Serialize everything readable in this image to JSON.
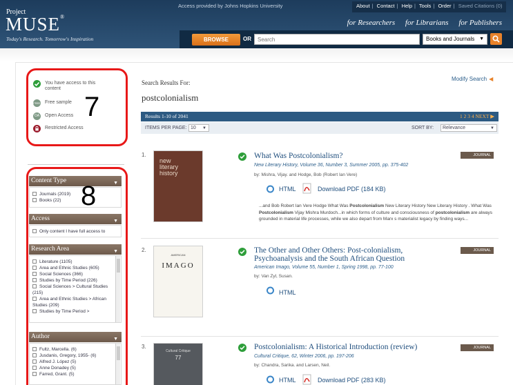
{
  "header": {
    "logo_project": "Project",
    "logo_muse": "MUSE",
    "logo_reg": "®",
    "tagline": "Today's Research. Tomorrow's Inspiration",
    "access_note": "Access provided by Johns Hopkins University",
    "top_links": [
      "About",
      "Contact",
      "Help",
      "Tools",
      "Order"
    ],
    "saved_citations": "Saved Citations (0)",
    "audiences": [
      "for Researchers",
      "for Librarians",
      "for Publishers"
    ],
    "browse_label": "BROWSE",
    "or_label": "OR",
    "search_placeholder": "Search",
    "scope_value": "Books and Journals"
  },
  "access_legend": {
    "items": [
      "You have access to this content",
      "Free sample",
      "Open Access",
      "Restricted Access"
    ],
    "annotation_number": "7"
  },
  "filters": {
    "annotation_number": "8",
    "content_type": {
      "title": "Content Type",
      "options": [
        "Journals (2019)",
        "Books (22)"
      ]
    },
    "access": {
      "title": "Access",
      "options": [
        "Only content I have full access to"
      ]
    },
    "research_area": {
      "title": "Research Area",
      "options": [
        "Literature (1105)",
        "Area and Ethnic Studies (605)",
        "Social Sciences (366)",
        "Studies by Time Period (226)",
        "Social Sciences > Cultural Studies (215)",
        "Area and Ethnic Studies > African Studies (209)",
        "Studies by Time Period >"
      ]
    },
    "author": {
      "title": "Author",
      "options": [
        "Fultz, Marcella. (6)",
        "Jusdanis, Gregory, 1955- (6)",
        "Alfred J. López (5)",
        "Anne Donadey (5)",
        "Farred, Grant. (5)"
      ]
    }
  },
  "results": {
    "label": "Search Results For:",
    "query": "postcolonialism",
    "modify_label": "Modify Search",
    "count_text": "Results 1-10 of 2041",
    "pages": [
      "1",
      "2",
      "3",
      "4"
    ],
    "next_label": "NEXT",
    "items_per_page_label": "ITEMS PER PAGE:",
    "items_per_page_value": "10",
    "sort_label": "SORT BY:",
    "sort_value": "Relevance",
    "items": [
      {
        "num": "1.",
        "title": "What Was Postcolonialism?",
        "source": "New Literary History, Volume 36, Number 3, Summer 2005, pp. 375-402",
        "by": "by: Mishra, Vijay. and Hodge, Bob (Robert Ian Vere)",
        "badge": "JOURNAL",
        "html_label": "HTML",
        "pdf_label": "Download PDF (184 KB)",
        "cover_text": "new literary history",
        "snippet_parts": [
          "...and Bob Robert Ian Vere Hodge What Was ",
          "Postcolonialism",
          " New Literary History New Literary History . What Was ",
          "Postcolonialism",
          " Vijay Mishra Murdoch...in which forms of culture and consciousness of ",
          "postcolonialism",
          " are always grounded in material life processes, while we also depart from Marx s materialist legacy by finding ways..."
        ]
      },
      {
        "num": "2.",
        "title": "The Other and Other Others: Post-colonialism, Psychoanalysis and the South African Question",
        "source": "American Imago, Volume 55, Number 1, Spring 1998, pp. 77-100",
        "by": "by: Van Zyl, Susan.",
        "badge": "JOURNAL",
        "html_label": "HTML",
        "cover_small": "AMERICAN",
        "cover_text": "IMAGO"
      },
      {
        "num": "3.",
        "title": "Postcolonialism: A Historical Introduction (review)",
        "source": "Cultural Critique, 62, Winter 2006, pp. 197-206",
        "by": "by: Chandra, Sarika. and Larsen, Neil.",
        "badge": "JOURNAL",
        "html_label": "HTML",
        "pdf_label": "Download PDF (283 KB)",
        "cover_text": "Cultural Critique",
        "cover_num": "77"
      }
    ]
  },
  "colors": {
    "header": "#1d3c5c",
    "accent": "#e8822a",
    "annotation": "#e81818",
    "panel": "#7a6656",
    "check": "#2e9e3a"
  }
}
